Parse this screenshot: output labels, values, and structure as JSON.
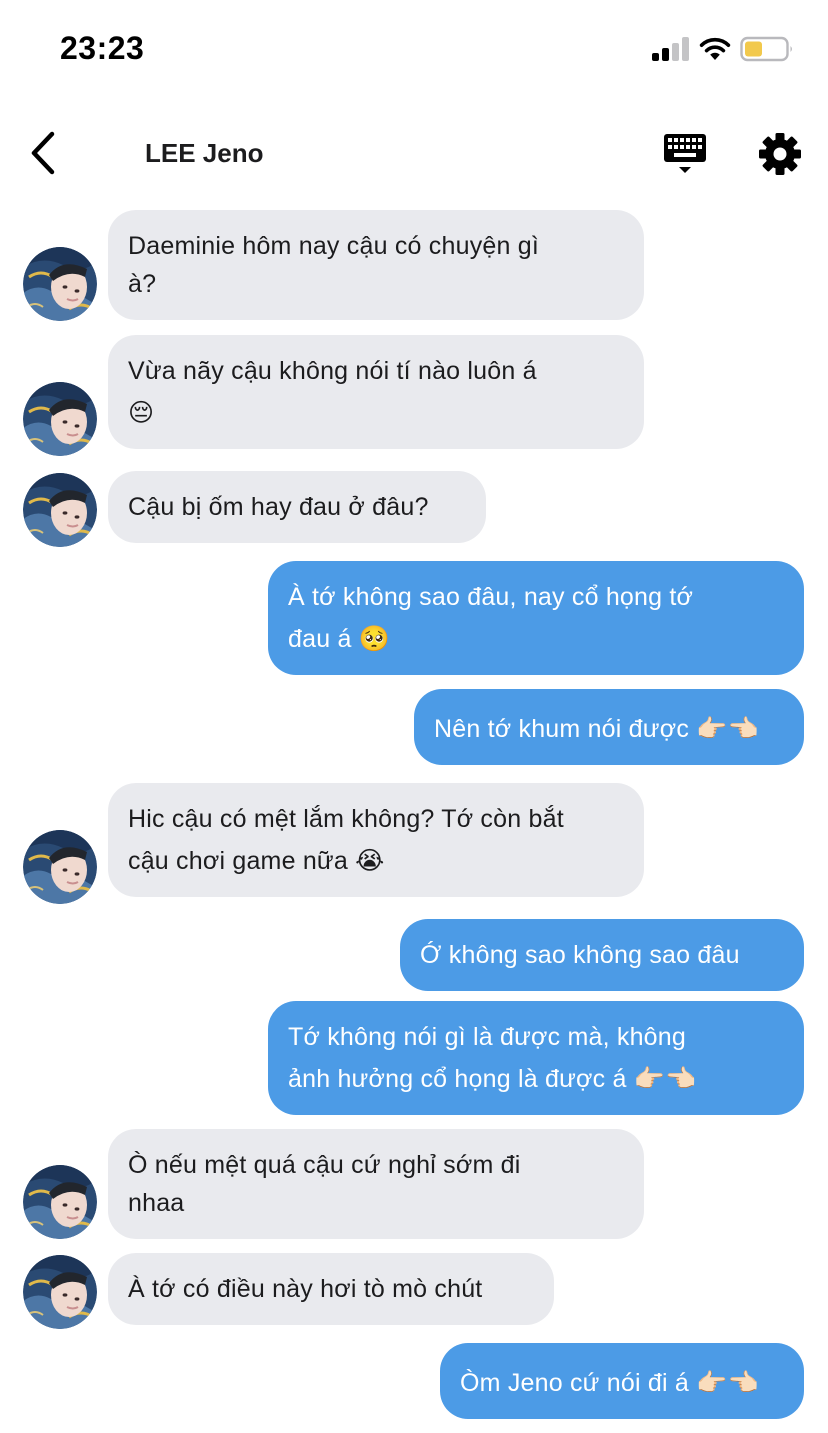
{
  "status_bar": {
    "time": "23:23",
    "battery_color": "#f2c94c"
  },
  "header": {
    "title": "LEE Jeno"
  },
  "colors": {
    "incoming_bubble": "#e9eaee",
    "outgoing_bubble": "#4c9be6"
  },
  "messages": [
    {
      "sender": "contact",
      "lines": [
        "Daeminie hôm nay cậu có chuyện gì",
        "à?"
      ]
    },
    {
      "sender": "contact",
      "lines": [
        "Vừa nãy cậu không nói tí nào luôn á",
        "😔"
      ]
    },
    {
      "sender": "contact",
      "lines": [
        "Cậu bị ốm hay đau ở đâu?"
      ]
    },
    {
      "sender": "me",
      "lines": [
        "À tớ không sao đâu, nay cổ họng tớ",
        "đau á 🥺"
      ]
    },
    {
      "sender": "me",
      "lines": [
        "Nên tớ khum nói được 👉🏻👈🏻"
      ]
    },
    {
      "sender": "contact",
      "lines": [
        "Hic cậu có mệt lắm không? Tớ còn bắt",
        "cậu chơi game nữa 😭"
      ]
    },
    {
      "sender": "me",
      "lines": [
        "Ớ không sao không sao đâu"
      ]
    },
    {
      "sender": "me",
      "lines": [
        "Tớ không nói gì là được mà, không",
        "ảnh hưởng cổ họng là được á 👉🏻👈🏻"
      ]
    },
    {
      "sender": "contact",
      "lines": [
        "Ò nếu mệt quá cậu cứ nghỉ sớm đi",
        "nhaa"
      ]
    },
    {
      "sender": "contact",
      "lines": [
        "À tớ có điều này hơi tò mò chút"
      ]
    },
    {
      "sender": "me",
      "lines": [
        "Òm Jeno cứ nói đi á 👉🏻👈🏻"
      ]
    }
  ]
}
